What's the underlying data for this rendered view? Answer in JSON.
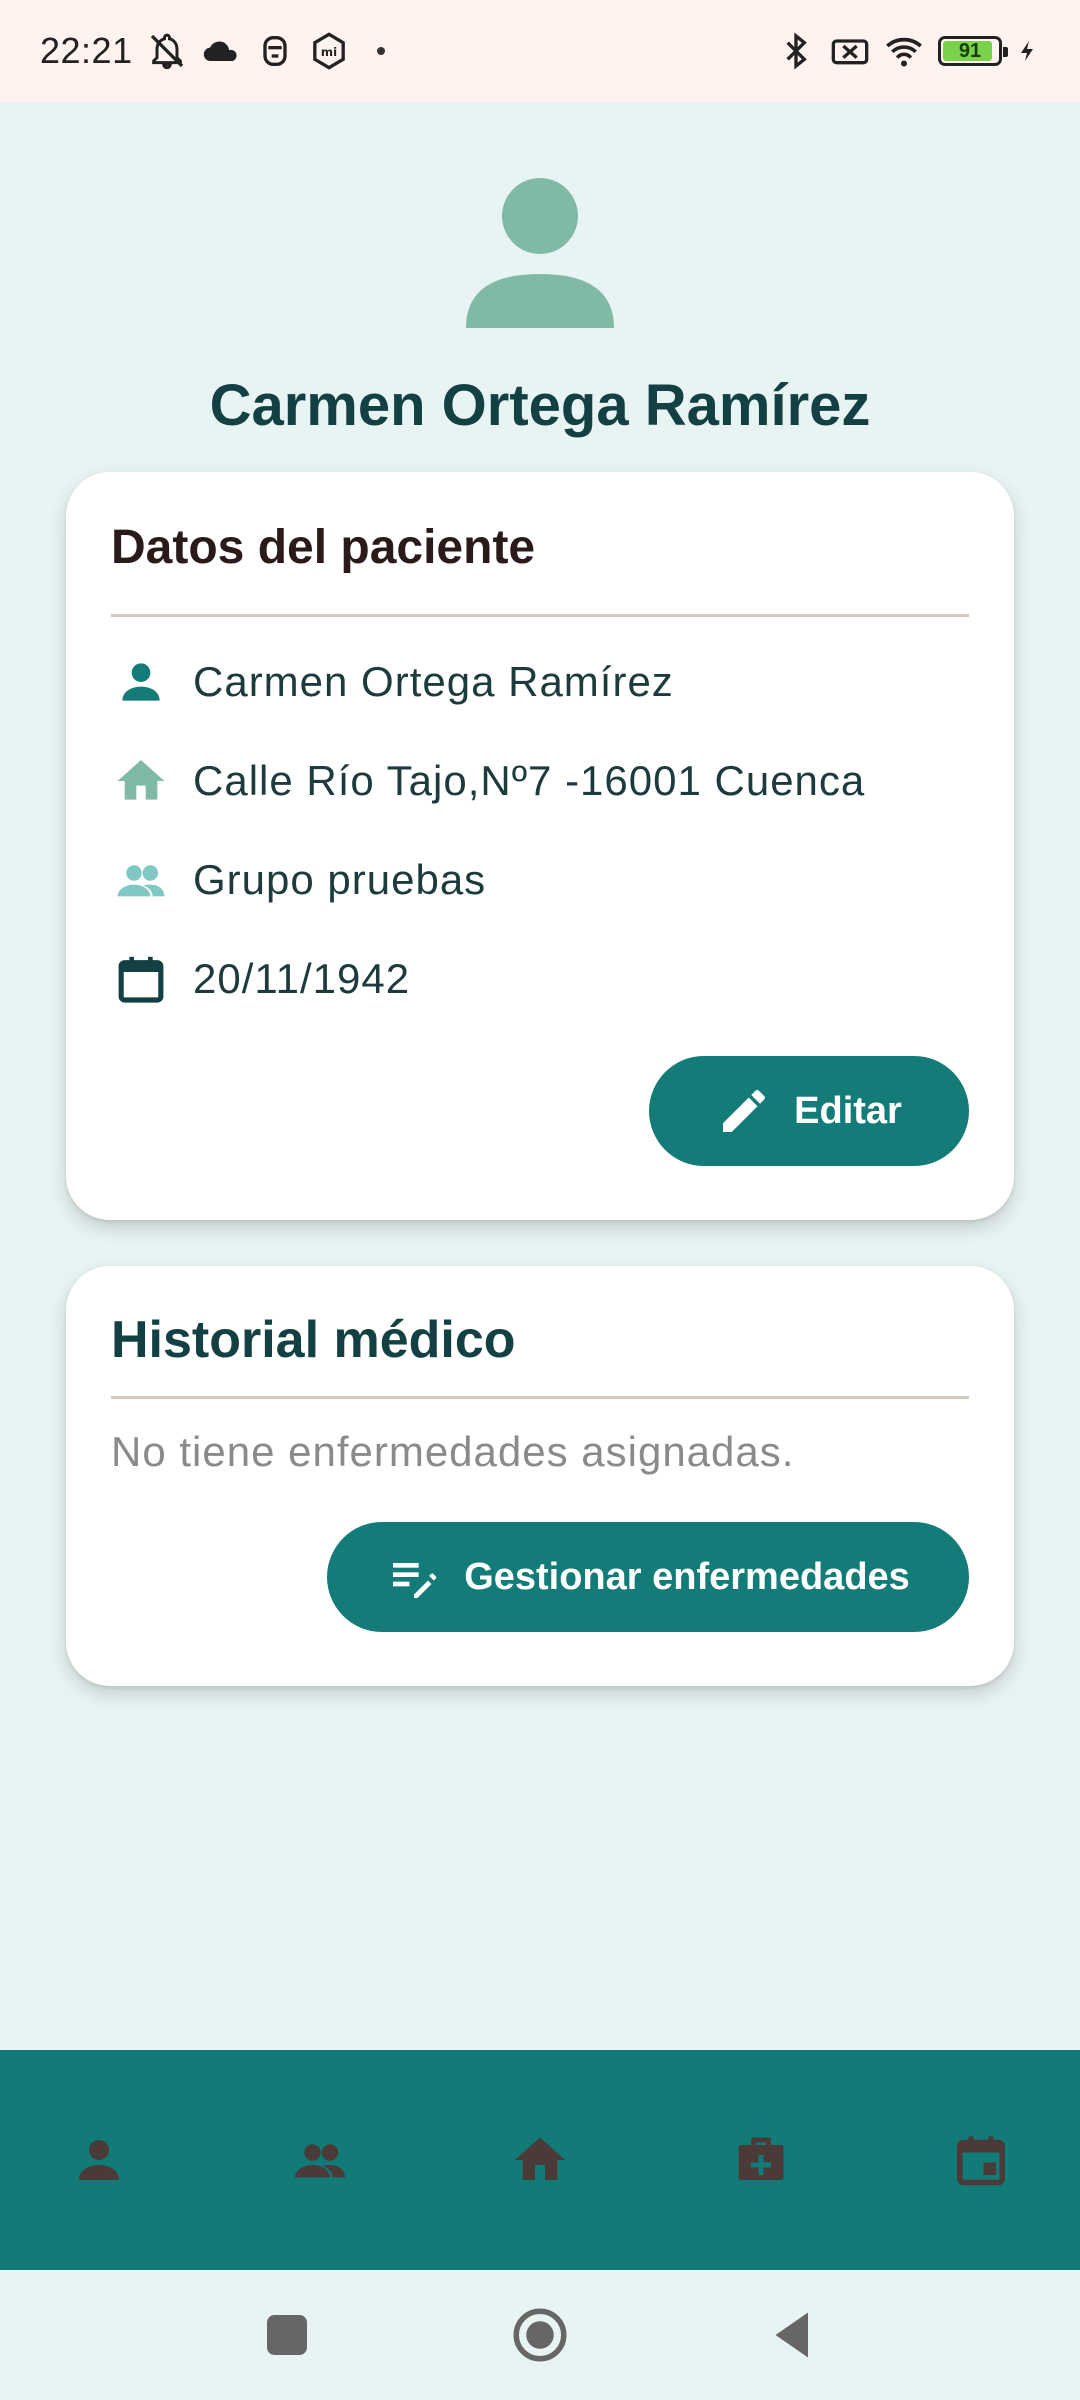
{
  "status_bar": {
    "time": "22:21",
    "battery_level": "91",
    "battery_fraction": 0.91,
    "left_icons": [
      "muted-bell-icon",
      "cloud-icon",
      "face-icon",
      "mi-icon"
    ],
    "right_icons": [
      "bluetooth-icon",
      "no-sim-icon",
      "wifi-icon",
      "battery-icon",
      "charging-icon"
    ]
  },
  "header": {
    "avatar_icon": "person-icon",
    "patient_name": "Carmen Ortega Ramírez"
  },
  "patient_card": {
    "title": "Datos del paciente",
    "rows": [
      {
        "icon": "person-icon",
        "text": "Carmen Ortega Ramírez"
      },
      {
        "icon": "home-icon",
        "text": "Calle Río Tajo,Nº7 -16001 Cuenca"
      },
      {
        "icon": "group-icon",
        "text": "Grupo pruebas"
      },
      {
        "icon": "calendar-icon",
        "text": "20/11/1942"
      }
    ],
    "edit_label": "Editar"
  },
  "history_card": {
    "title": "Historial médico",
    "empty_text": "No tiene enfermedades asignadas.",
    "manage_label": "Gestionar enfermedades"
  },
  "bottom_nav": {
    "items": [
      {
        "icon": "person-icon"
      },
      {
        "icon": "group-icon"
      },
      {
        "icon": "home-icon"
      },
      {
        "icon": "medical-bag-icon"
      },
      {
        "icon": "calendar-icon"
      }
    ]
  },
  "system_nav": [
    "recents-icon",
    "home-circle-icon",
    "back-icon"
  ],
  "colors": {
    "primary": "#137b78",
    "background": "#e8f4f3",
    "avatar": "#80baa6",
    "nav_icon": "#4a3a38"
  }
}
